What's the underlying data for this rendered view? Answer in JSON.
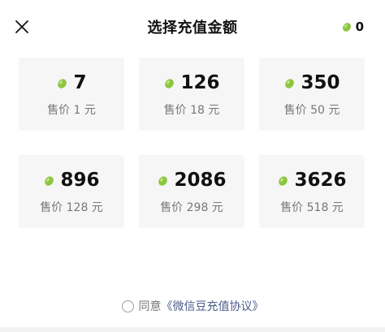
{
  "header": {
    "title": "选择充值金额",
    "balance": "0"
  },
  "packages": [
    {
      "amount": "7",
      "price": "售价 1 元"
    },
    {
      "amount": "126",
      "price": "售价 18 元"
    },
    {
      "amount": "350",
      "price": "售价 50 元"
    },
    {
      "amount": "896",
      "price": "售价 128 元"
    },
    {
      "amount": "2086",
      "price": "售价 298 元"
    },
    {
      "amount": "3626",
      "price": "售价 518 元"
    }
  ],
  "agreement": {
    "prefix": "同意",
    "link": "《微信豆充值协议》",
    "checked": false
  },
  "icons": {
    "close": "close-icon",
    "bean": "wechat-bean-icon"
  },
  "colors": {
    "bean": "#8cc63f",
    "card_bg": "#f6f6f6",
    "link": "#4c5d8a",
    "muted": "#777777"
  }
}
